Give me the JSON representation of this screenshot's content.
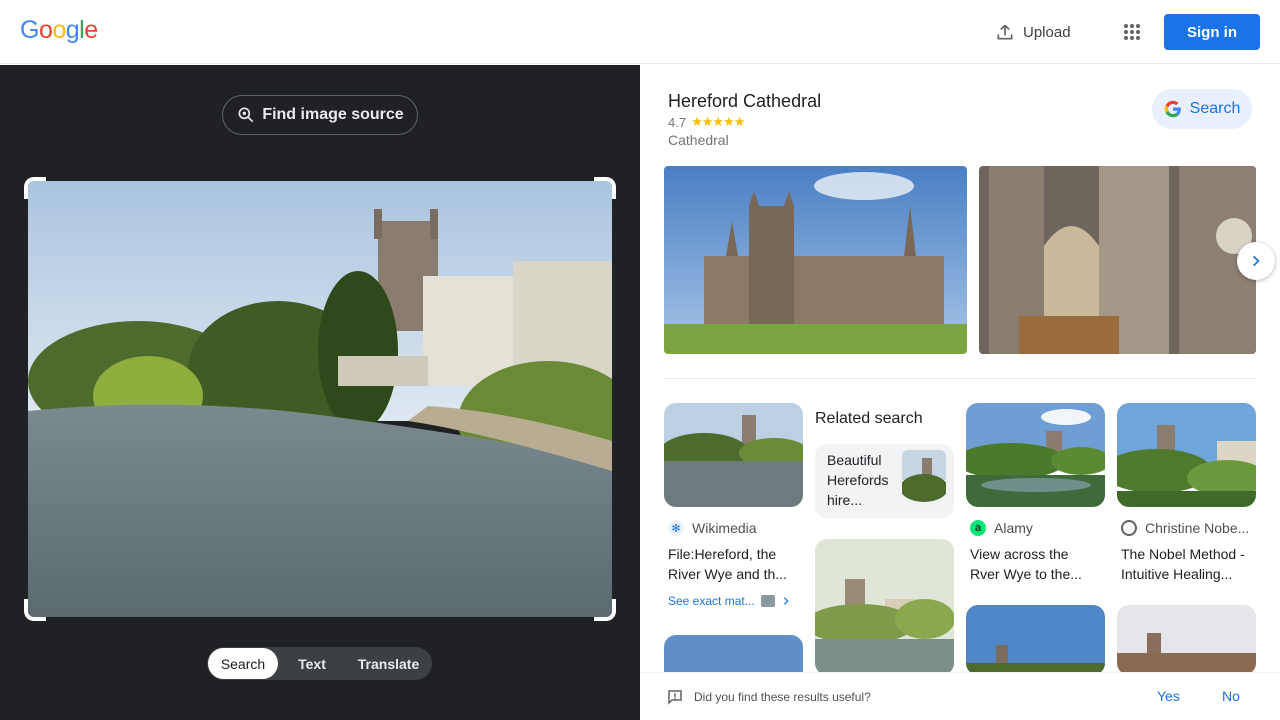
{
  "header": {
    "logo_letters": [
      "G",
      "o",
      "o",
      "g",
      "l",
      "e"
    ],
    "logo_colors": [
      "#4285f4",
      "#ea4335",
      "#fbbc05",
      "#4285f4",
      "#34a853",
      "#ea4335"
    ],
    "upload_label": "Upload",
    "apps_icon": "apps-grid-icon",
    "signin_label": "Sign in"
  },
  "left": {
    "find_source_label": "Find image source",
    "modes": [
      {
        "label": "Search",
        "active": true
      },
      {
        "label": "Text",
        "active": false
      },
      {
        "label": "Translate",
        "active": false
      }
    ]
  },
  "knowledge_panel": {
    "title": "Hereford Cathedral",
    "rating": "4.7",
    "stars": "★★★★★",
    "type": "Cathedral",
    "search_label": "Search"
  },
  "results": {
    "related_search_label": "Related search",
    "related_card_text": "Beautiful Herefords hire...",
    "items": [
      {
        "source": "Wikimedia",
        "title": "File:Hereford, the River Wye and th..."
      },
      {
        "source": "Alamy",
        "title": "View across the Rver Wye to the..."
      },
      {
        "source": "Christine Nobe...",
        "title": "The Nobel Method - Intuitive Healing..."
      }
    ],
    "see_exact_label": "See exact mat..."
  },
  "feedback": {
    "question": "Did you find these results useful?",
    "yes": "Yes",
    "no": "No"
  },
  "colors": {
    "accent": "#1a73e8",
    "dark_panel": "#202124",
    "star": "#fbbc04"
  }
}
